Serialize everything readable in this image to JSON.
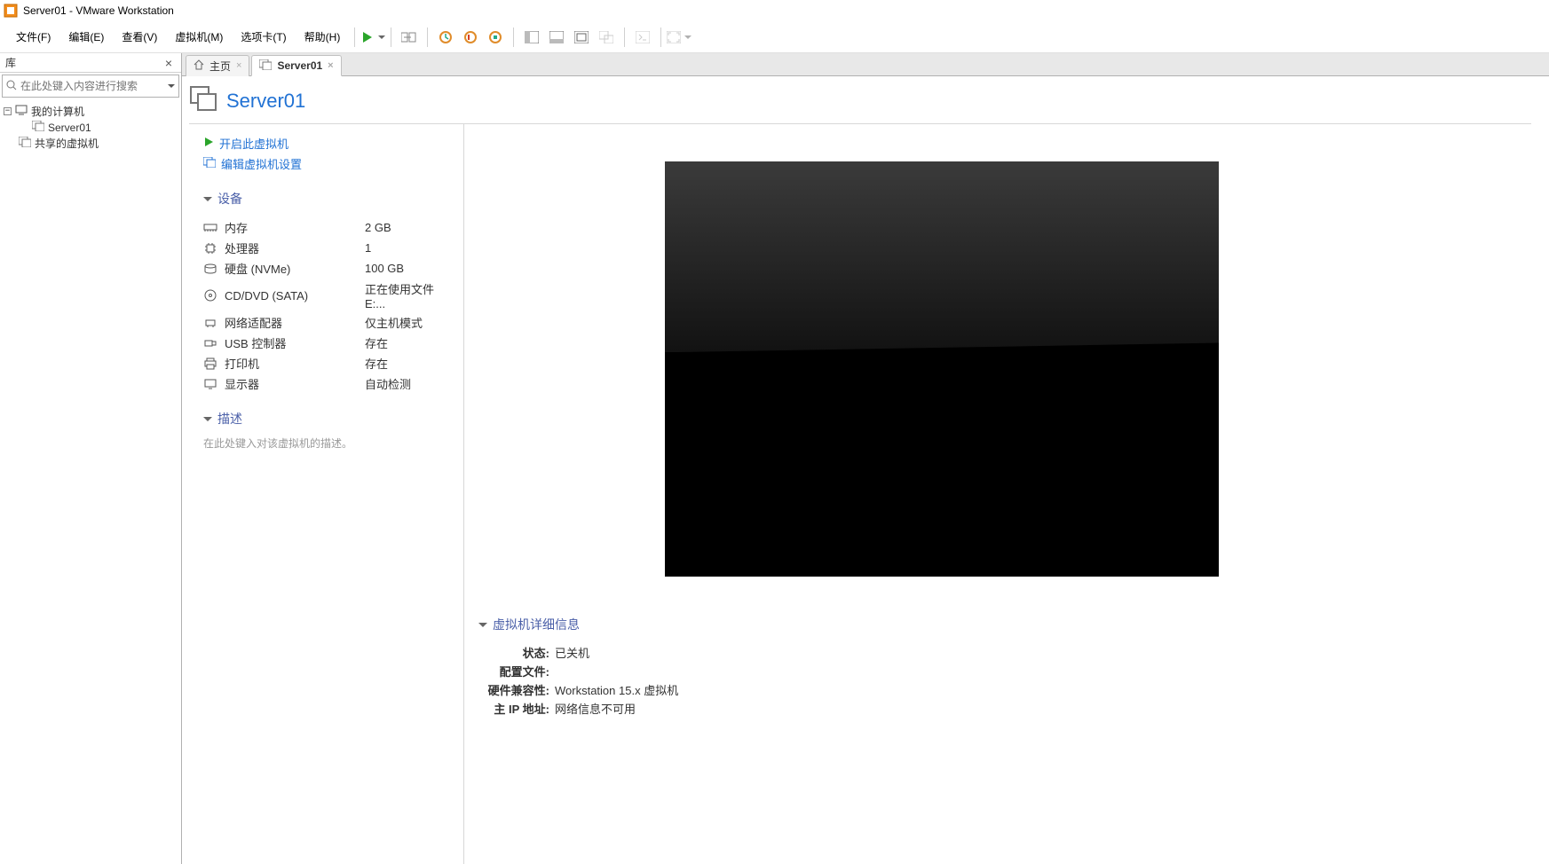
{
  "window": {
    "title": "Server01 - VMware Workstation"
  },
  "menus": {
    "file": "文件(F)",
    "edit": "编辑(E)",
    "view": "查看(V)",
    "vm": "虚拟机(M)",
    "tabs": "选项卡(T)",
    "help": "帮助(H)"
  },
  "sidebar": {
    "library_label": "库",
    "search_placeholder": "在此处键入内容进行搜索",
    "nodes": {
      "my_computer": "我的计算机",
      "server01": "Server01",
      "shared_vms": "共享的虚拟机"
    }
  },
  "tabs": {
    "home": "主页",
    "server01": "Server01"
  },
  "vm": {
    "name": "Server01",
    "actions": {
      "power_on": "开启此虚拟机",
      "edit_settings": "编辑虚拟机设置"
    },
    "sections": {
      "devices": "设备",
      "description": "描述",
      "details": "虚拟机详细信息"
    },
    "devices": [
      {
        "icon": "memory",
        "name": "内存",
        "value": "2 GB"
      },
      {
        "icon": "cpu",
        "name": "处理器",
        "value": "1"
      },
      {
        "icon": "disk",
        "name": "硬盘 (NVMe)",
        "value": "100 GB"
      },
      {
        "icon": "cd",
        "name": "CD/DVD (SATA)",
        "value": "正在使用文件 E:..."
      },
      {
        "icon": "net",
        "name": "网络适配器",
        "value": "仅主机模式"
      },
      {
        "icon": "usb",
        "name": "USB 控制器",
        "value": "存在"
      },
      {
        "icon": "printer",
        "name": "打印机",
        "value": "存在"
      },
      {
        "icon": "display",
        "name": "显示器",
        "value": "自动检测"
      }
    ],
    "description_placeholder": "在此处键入对该虚拟机的描述。",
    "details": {
      "state_label": "状态:",
      "state_value": "已关机",
      "config_label": "配置文件:",
      "config_value": "",
      "compat_label": "硬件兼容性:",
      "compat_value": "Workstation 15.x 虚拟机",
      "ip_label": "主 IP 地址:",
      "ip_value": "网络信息不可用"
    }
  }
}
